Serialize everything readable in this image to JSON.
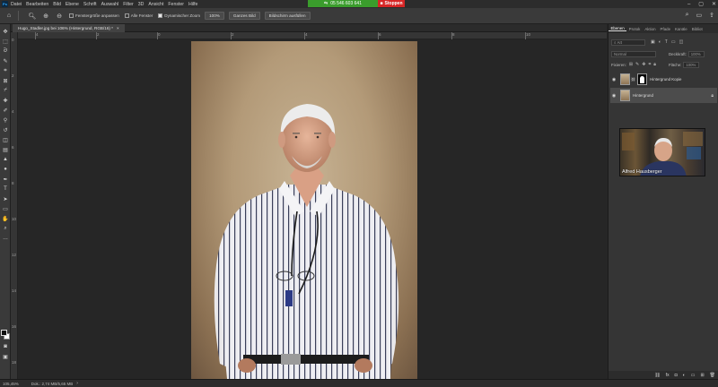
{
  "menubar": {
    "app_logo": "Ps",
    "items": [
      "Datei",
      "Bearbeiten",
      "Bild",
      "Ebene",
      "Schrift",
      "Auswahl",
      "Filter",
      "3D",
      "Ansicht",
      "Fenster",
      "Hilfe"
    ],
    "share_id": "05 546 603 641",
    "share_stop": "Stoppen",
    "share_color": "#3a9d2c",
    "stop_color": "#d72626"
  },
  "options": {
    "resize_windows": "Fenstergröße anpassen",
    "all_windows": "Alle Fenster",
    "scrubby_zoom": "Dynamischer Zoom",
    "zoom_percent": "100%",
    "fit_screen": "Ganzes Bild",
    "fill_screen": "Bildschirm ausfüllen"
  },
  "document": {
    "tab_title": "Hugo_Stadler.jpg bei 106% (Hintergrund, RGB/16) *",
    "close_icon": "close-icon"
  },
  "rulers": {
    "top": [
      "4",
      "2",
      "0",
      "2",
      "4",
      "6",
      "8",
      "10"
    ],
    "left": [
      "0",
      "2",
      "4",
      "6",
      "8",
      "10",
      "12",
      "14",
      "16",
      "18"
    ]
  },
  "panel": {
    "tabs": [
      "Ebenen",
      "Protok",
      "Aktion",
      "Pfade",
      "Kanäle",
      "Bibliot"
    ],
    "active_tab": "Ebenen",
    "filter_label": "Art",
    "blend_mode": "Normal",
    "opacity_label": "Deckkraft:",
    "opacity_value": "100%",
    "lock_label": "Fixieren:",
    "fill_label": "Fläche:",
    "fill_value": "100%",
    "layers": [
      {
        "name": "Hintergrund Kopie",
        "visible": true,
        "has_mask": true,
        "locked": false,
        "selected": false
      },
      {
        "name": "Hintergrund",
        "visible": true,
        "has_mask": false,
        "locked": true,
        "selected": true
      }
    ]
  },
  "webcam": {
    "name": "Alfred Hausberger"
  },
  "status": {
    "zoom": "105,45%",
    "doc_size": "Dok.: 2,74 MB/5,65 MB"
  }
}
